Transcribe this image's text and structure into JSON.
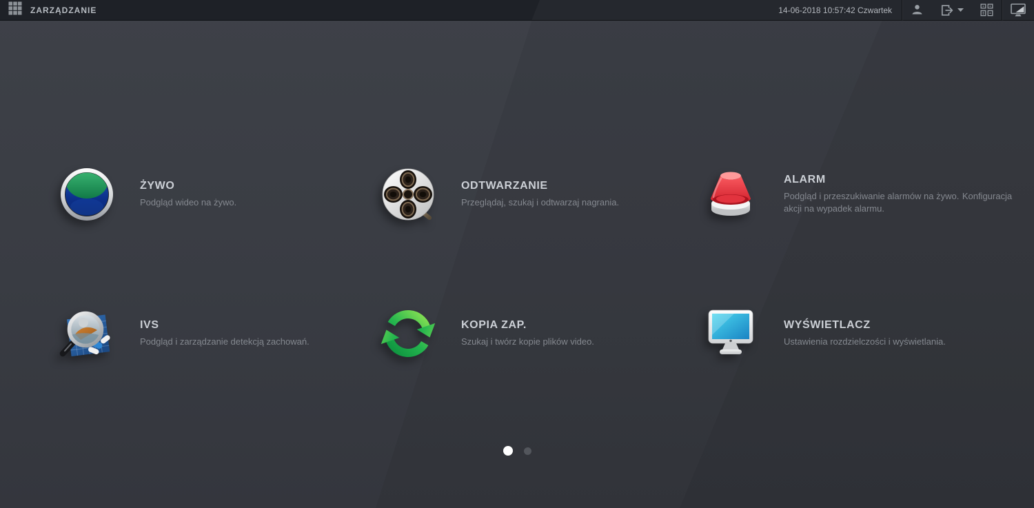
{
  "topbar": {
    "app_title": "ZARZĄDZANIE",
    "datetime": "14-06-2018 10:57:42 Czwartek",
    "icons": [
      "apps-grid-icon",
      "user-icon",
      "logout-icon",
      "caret-down-icon",
      "qr-channels-icon",
      "display-toggle-icon"
    ]
  },
  "menu": {
    "items": [
      {
        "title": "ŻYWO",
        "desc1": "Podgląd wideo na żywo.",
        "desc2": "",
        "icon": "live-view-orb-icon"
      },
      {
        "title": "ODTWARZANIE",
        "desc1": "Przeglądaj, szukaj i odtwarzaj nagrania.",
        "desc2": "",
        "icon": "film-reel-icon"
      },
      {
        "title": "ALARM",
        "desc1": "Podgląd i przeszukiwanie alarmów na żywo.",
        "desc2": "Konfiguracja akcji na wypadek alarmu.",
        "icon": "siren-icon"
      },
      {
        "title": "IVS",
        "desc1": "Podgląd i zarządzanie detekcją zachowań.",
        "desc2": "",
        "icon": "magnifier-analytics-icon"
      },
      {
        "title": "KOPIA ZAP.",
        "desc1": "Szukaj i twórz kopie plików video.",
        "desc2": "",
        "icon": "backup-sync-icon"
      },
      {
        "title": "WYŚWIETLACZ",
        "desc1": "Ustawienia rozdzielczości i wyświetlania.",
        "desc2": "",
        "icon": "display-monitor-icon"
      }
    ]
  },
  "pagination": {
    "dot_count": 2,
    "active_dot": 1
  },
  "colors": {
    "background": "#3b3e45",
    "topbar": "#1e2127",
    "title_text": "#ccd0d6",
    "desc_text": "#84888f",
    "orb_green": "#2fb26b",
    "orb_blue": "#0b2f86",
    "siren_red": "#e03238",
    "sync_green": "#24b54e",
    "screen_cyan": "#35c8e8",
    "dot_active": "#ffffff",
    "dot_inactive": "#53565c"
  }
}
